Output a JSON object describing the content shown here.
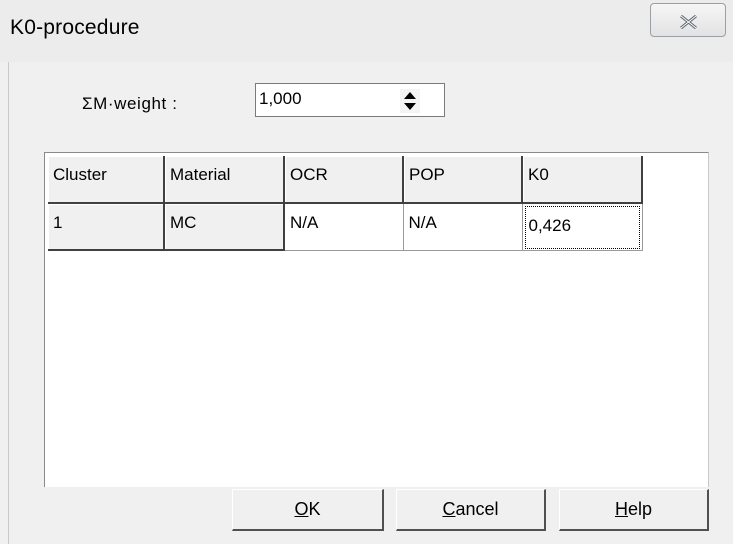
{
  "window": {
    "title": "K0-procedure",
    "close_icon": "close-x-icon"
  },
  "weight": {
    "label": "ΣM·weight :",
    "value": "1,000"
  },
  "grid": {
    "columns": [
      "Cluster",
      "Material",
      "OCR",
      "POP",
      "K0"
    ],
    "rows": [
      {
        "cluster": "1",
        "material": "MC",
        "ocr": "N/A",
        "pop": "N/A",
        "k0": "0,426"
      }
    ]
  },
  "buttons": {
    "ok_label": "OK",
    "ok_mnemonic": "O",
    "ok_rest": "K",
    "cancel_label": "Cancel",
    "cancel_mnemonic": "C",
    "cancel_rest": "ancel",
    "help_label": "Help",
    "help_mnemonic": "H",
    "help_rest": "elp"
  }
}
